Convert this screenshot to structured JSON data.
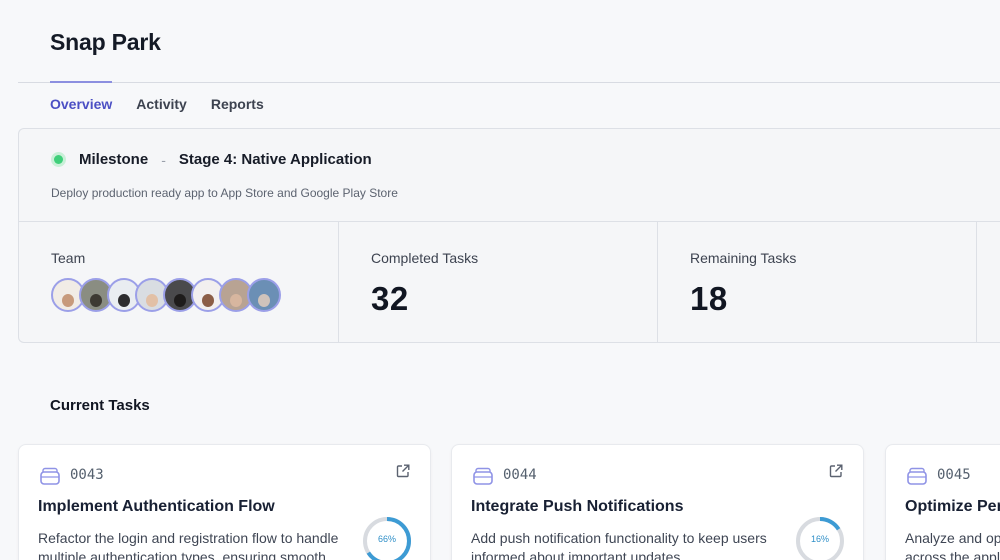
{
  "app": {
    "title": "Snap Park"
  },
  "tabs": [
    {
      "label": "Overview",
      "active": true
    },
    {
      "label": "Activity",
      "active": false
    },
    {
      "label": "Reports",
      "active": false
    }
  ],
  "milestone": {
    "label": "Milestone",
    "separator": "-",
    "stage": "Stage 4: Native Application",
    "description": "Deploy production ready app to App Store and Google Play Store",
    "status_color": "#3fcf7a"
  },
  "stats": {
    "team_label": "Team",
    "team_member_count": 8,
    "completed_label": "Completed Tasks",
    "completed_value": "32",
    "remaining_label": "Remaining Tasks",
    "remaining_value": "18"
  },
  "current_tasks": {
    "title": "Current Tasks",
    "cards": [
      {
        "id": "0043",
        "title": "Implement Authentication Flow",
        "description": "Refactor the login and registration flow to handle multiple authentication types, ensuring smooth",
        "progress": 66,
        "progress_label": "66%"
      },
      {
        "id": "0044",
        "title": "Integrate Push Notifications",
        "description": "Add push notification functionality to keep users informed about important updates",
        "progress": 16,
        "progress_label": "16%"
      },
      {
        "id": "0045",
        "title": "Optimize Per",
        "description": "Analyze and op across the appl",
        "progress": null,
        "progress_label": ""
      }
    ]
  },
  "colors": {
    "accent": "#4b4fc4",
    "progress_fill": "#3d9bd4",
    "progress_track": "#d8dbe0"
  }
}
